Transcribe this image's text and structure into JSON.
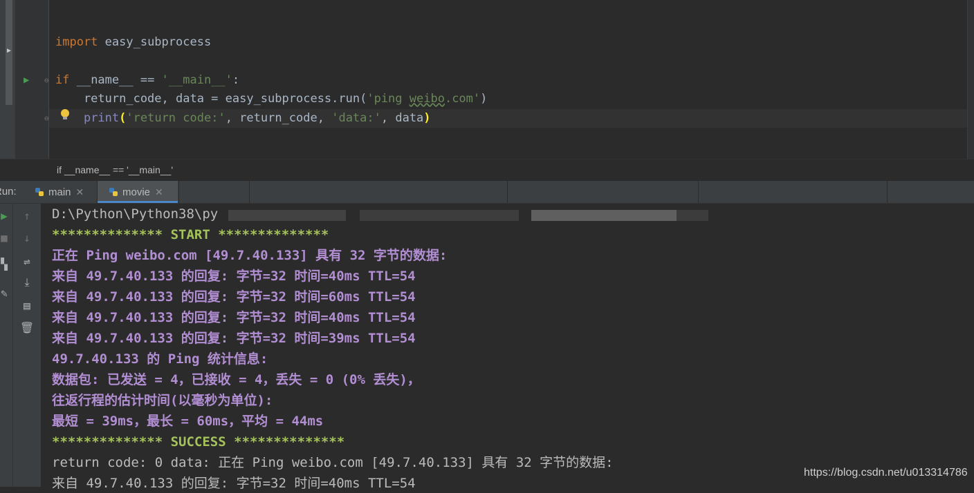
{
  "editor": {
    "lines": [
      {
        "parts": [
          {
            "t": "import",
            "c": "kw"
          },
          {
            "t": " easy_subprocess",
            "c": ""
          }
        ]
      },
      {
        "parts": [
          {
            "t": "if",
            "c": "kw"
          },
          {
            "t": " __name__ == ",
            "c": ""
          },
          {
            "t": "'__main__'",
            "c": "str"
          },
          {
            "t": ":",
            "c": ""
          }
        ]
      },
      {
        "parts": [
          {
            "t": "    return_code, data = easy_subprocess.run(",
            "c": ""
          },
          {
            "t": "'ping ",
            "c": "str"
          },
          {
            "t": "weibo",
            "c": "str squig"
          },
          {
            "t": ".com'",
            "c": "str"
          },
          {
            "t": ")",
            "c": ""
          }
        ]
      },
      {
        "parts": [
          {
            "t": "    ",
            "c": ""
          },
          {
            "t": "print",
            "c": "fn"
          },
          {
            "t": "(",
            "c": "pm"
          },
          {
            "t": "'return code:'",
            "c": "str"
          },
          {
            "t": ", return_code, ",
            "c": ""
          },
          {
            "t": "'data:'",
            "c": "str"
          },
          {
            "t": ", data",
            "c": ""
          },
          {
            "t": ")",
            "c": "pm"
          }
        ]
      }
    ],
    "breadcrumb": "if __name__ == '__main__'"
  },
  "run_window": {
    "label": "Run:",
    "tabs": [
      {
        "label": "main",
        "active": false
      },
      {
        "label": "movie",
        "active": true
      }
    ]
  },
  "console": {
    "lines": [
      {
        "text": "D:\\Python\\Python38\\py",
        "style": "gray"
      },
      {
        "text": "************** START **************",
        "style": "green"
      },
      {
        "text": "正在 Ping weibo.com [49.7.40.133] 具有 32 字节的数据:",
        "style": "purple"
      },
      {
        "text": "来自 49.7.40.133 的回复: 字节=32 时间=40ms TTL=54",
        "style": "purple"
      },
      {
        "text": "来自 49.7.40.133 的回复: 字节=32 时间=60ms TTL=54",
        "style": "purple"
      },
      {
        "text": "来自 49.7.40.133 的回复: 字节=32 时间=40ms TTL=54",
        "style": "purple"
      },
      {
        "text": "来自 49.7.40.133 的回复: 字节=32 时间=39ms TTL=54",
        "style": "purple"
      },
      {
        "text": "49.7.40.133 的 Ping 统计信息:",
        "style": "purple"
      },
      {
        "text": "数据包: 已发送 = 4，已接收 = 4，丢失 = 0 (0% 丢失)，",
        "style": "purple"
      },
      {
        "text": "往返行程的估计时间(以毫秒为单位):",
        "style": "purple"
      },
      {
        "text": "最短 = 39ms，最长 = 60ms，平均 = 44ms",
        "style": "purple"
      },
      {
        "text": "************** SUCCESS **************",
        "style": "green"
      },
      {
        "text": "return code: 0 data: 正在 Ping weibo.com [49.7.40.133] 具有 32 字节的数据:",
        "style": "gray"
      },
      {
        "text": "来自 49.7.40.133 的回复: 字节=32 时间=40ms TTL=54",
        "style": "gray"
      }
    ]
  },
  "watermark": "https://blog.csdn.net/u013314786",
  "colors": {
    "background": "#2b2b2b",
    "keyword": "#cc7832",
    "string": "#6a8759",
    "console_green": "#a5c25c",
    "console_purple": "#b28ed3",
    "tab_underline": "#4a88c7"
  },
  "icons": [
    "run-gutter-icon",
    "fold-icon",
    "intention-bulb-icon",
    "python-file-icon",
    "close-icon",
    "rerun-icon",
    "stop-icon",
    "layout-icon",
    "pin-icon",
    "up-arrow-icon",
    "down-arrow-icon",
    "soft-wrap-icon",
    "scroll-to-end-icon",
    "print-icon",
    "trash-icon"
  ]
}
